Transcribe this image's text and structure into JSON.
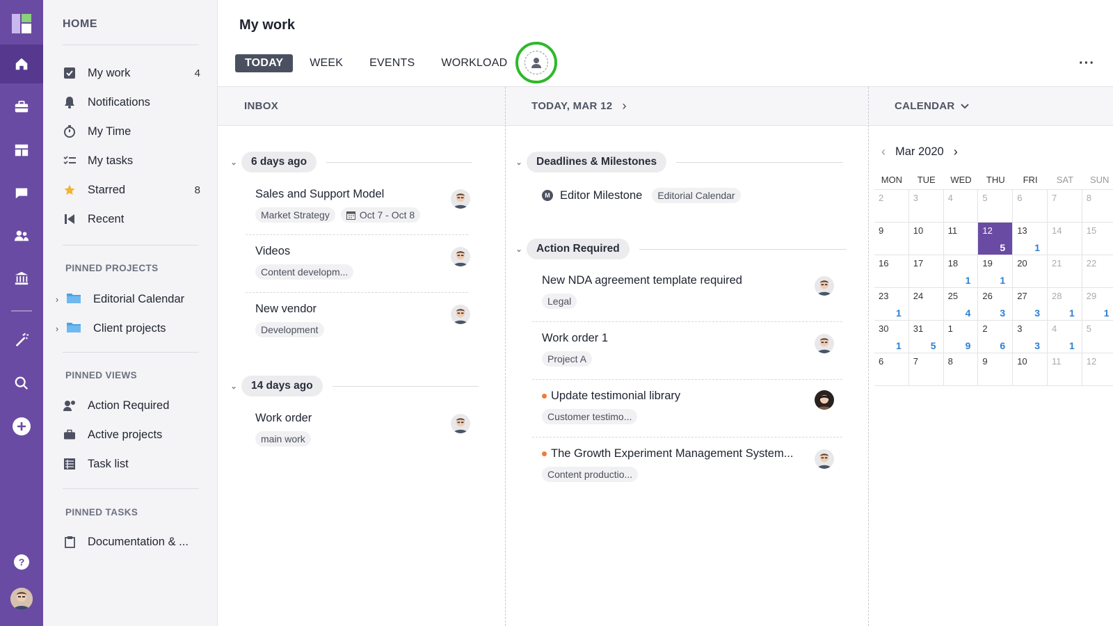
{
  "rail": {
    "icons": [
      "logo-icon",
      "home-icon",
      "briefcase-icon",
      "dashboard-icon",
      "chat-icon",
      "team-icon",
      "bank-icon",
      "magic-wand-icon",
      "search-icon",
      "plus-icon",
      "help-icon"
    ]
  },
  "sidebar": {
    "home": "HOME",
    "items": [
      {
        "label": "My work",
        "count": "4",
        "icon": "checkbox-icon"
      },
      {
        "label": "Notifications",
        "count": "",
        "icon": "bell-icon"
      },
      {
        "label": "My Time",
        "count": "",
        "icon": "stopwatch-icon"
      },
      {
        "label": "My tasks",
        "count": "",
        "icon": "task-list-icon"
      },
      {
        "label": "Starred",
        "count": "8",
        "icon": "star-icon"
      },
      {
        "label": "Recent",
        "count": "",
        "icon": "recent-icon"
      }
    ],
    "pinned_projects_title": "PINNED PROJECTS",
    "pinned_projects": [
      {
        "label": "Editorial Calendar"
      },
      {
        "label": "Client projects"
      }
    ],
    "pinned_views_title": "PINNED VIEWS",
    "pinned_views": [
      {
        "label": "Action Required",
        "icon": "user-alert-icon"
      },
      {
        "label": "Active projects",
        "icon": "briefcase-icon"
      },
      {
        "label": "Task list",
        "icon": "table-icon"
      }
    ],
    "pinned_tasks_title": "PINNED TASKS",
    "pinned_tasks": [
      {
        "label": "Documentation & ...",
        "icon": "clipboard-icon"
      }
    ]
  },
  "header": {
    "title": "My work",
    "tabs": [
      "TODAY",
      "WEEK",
      "EVENTS",
      "WORKLOAD"
    ],
    "active_tab": "TODAY",
    "more": "···"
  },
  "inbox": {
    "title": "INBOX",
    "groups": [
      {
        "label": "6 days ago",
        "tasks": [
          {
            "title": "Sales and Support Model",
            "tags": [
              "Market Strategy"
            ],
            "date": "Oct 7 - Oct 8"
          },
          {
            "title": "Videos",
            "tags": [
              "Content developm..."
            ]
          },
          {
            "title": "New vendor",
            "tags": [
              "Development"
            ]
          }
        ]
      },
      {
        "label": "14 days ago",
        "tasks": [
          {
            "title": "Work order",
            "tags": [
              "main work"
            ]
          }
        ]
      }
    ]
  },
  "today": {
    "title": "TODAY, MAR 12",
    "groups": [
      {
        "label": "Deadlines & Milestones"
      },
      {
        "label": "Action Required"
      }
    ],
    "milestone": {
      "title": "Editor Milestone",
      "tag": "Editorial Calendar",
      "icon_letter": "M"
    },
    "tasks": [
      {
        "title": "New NDA agreement template required",
        "tag": "Legal"
      },
      {
        "title": "Work order 1",
        "tag": "Project A"
      },
      {
        "title": "Update testimonial library",
        "tag": "Customer testimo..."
      },
      {
        "title": "The Growth Experiment Management System...",
        "tag": "Content productio..."
      }
    ]
  },
  "calendar": {
    "title": "CALENDAR",
    "month": "Mar 2020",
    "dows": [
      "MON",
      "TUE",
      "WED",
      "THU",
      "FRI",
      "SAT",
      "SUN"
    ],
    "weeks": [
      [
        [
          "2",
          ""
        ],
        [
          "3",
          ""
        ],
        [
          "4",
          ""
        ],
        [
          "5",
          ""
        ],
        [
          "6",
          ""
        ],
        [
          "7",
          ""
        ],
        [
          "8",
          ""
        ]
      ],
      [
        [
          "9",
          ""
        ],
        [
          "10",
          ""
        ],
        [
          "11",
          ""
        ],
        [
          "12",
          "5"
        ],
        [
          "13",
          "1"
        ],
        [
          "14",
          ""
        ],
        [
          "15",
          ""
        ]
      ],
      [
        [
          "16",
          ""
        ],
        [
          "17",
          ""
        ],
        [
          "18",
          "1"
        ],
        [
          "19",
          "1"
        ],
        [
          "20",
          ""
        ],
        [
          "21",
          ""
        ],
        [
          "22",
          ""
        ]
      ],
      [
        [
          "23",
          "1"
        ],
        [
          "24",
          ""
        ],
        [
          "25",
          "4"
        ],
        [
          "26",
          "3"
        ],
        [
          "27",
          "3"
        ],
        [
          "28",
          "1"
        ],
        [
          "29",
          "1"
        ]
      ],
      [
        [
          "30",
          "1"
        ],
        [
          "31",
          "5"
        ],
        [
          "1",
          "9"
        ],
        [
          "2",
          "6"
        ],
        [
          "3",
          "3"
        ],
        [
          "4",
          "1"
        ],
        [
          "5",
          ""
        ]
      ],
      [
        [
          "6",
          ""
        ],
        [
          "7",
          ""
        ],
        [
          "8",
          ""
        ],
        [
          "9",
          ""
        ],
        [
          "10",
          ""
        ],
        [
          "11",
          ""
        ],
        [
          "12",
          ""
        ]
      ]
    ],
    "today": "12",
    "colors": {
      "accent": "#6a4ba3",
      "count": "#2b7fd4"
    }
  }
}
